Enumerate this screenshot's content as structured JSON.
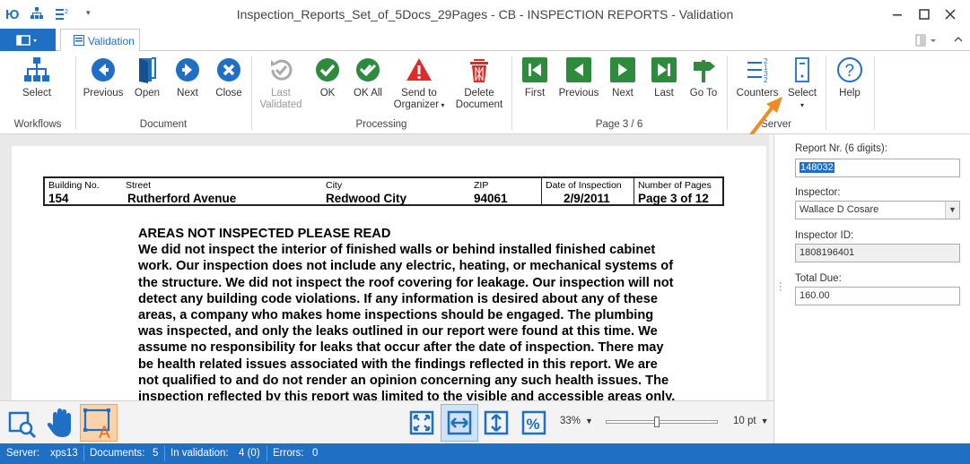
{
  "window": {
    "title": "Inspection_Reports_Set_of_5Docs_29Pages - CB - INSPECTION REPORTS - Validation"
  },
  "tabs": {
    "validation": "Validation"
  },
  "ribbon": {
    "workflows": {
      "group": "Workflows",
      "select": "Select"
    },
    "document": {
      "group": "Document",
      "previous": "Previous",
      "open": "Open",
      "next": "Next",
      "close": "Close"
    },
    "processing": {
      "group": "Processing",
      "last_validated_1": "Last",
      "last_validated_2": "Validated",
      "ok": "OK",
      "ok_all": "OK All",
      "send_1": "Send to",
      "send_2": "Organizer",
      "delete_1": "Delete",
      "delete_2": "Document"
    },
    "page": {
      "group": "Page 3 / 6",
      "first": "First",
      "previous": "Previous",
      "next": "Next",
      "last": "Last",
      "goto": "Go To"
    },
    "server": {
      "group": "Server",
      "counters": "Counters",
      "select": "Select"
    },
    "help": {
      "label": "Help"
    }
  },
  "document": {
    "header": {
      "building_label": "Building No.",
      "building_value": "154",
      "street_label": "Street",
      "street_value": "Rutherford Avenue",
      "city_label": "City",
      "city_value": "Redwood City",
      "zip_label": "ZIP",
      "zip_value": "94061",
      "date_label": "Date of Inspection",
      "date_value": "2/9/2011",
      "pages_label": "Number of Pages",
      "pages_value": "Page 3 of 12"
    },
    "heading": "AREAS NOT INSPECTED PLEASE READ",
    "lines": [
      "We did not inspect the interior of finished walls or behind installed finished cabinet",
      "work. Our inspection does not include any electric, heating, or mechanical systems of",
      "the structure. We did not inspect the roof covering for leakage. Our inspection will not",
      "detect any building code violations. If any information is desired about any of these",
      "areas, a company who makes home inspections should be engaged. The plumbing",
      "was inspected, and only the leaks outlined in our report were found at this time. We",
      "assume no responsibility for leaks that occur after the date of inspection. There may",
      "be health related issues associated with the findings reflected in this report. We are",
      "not qualified to and do not render an opinion concerning any such health issues. The",
      "inspection reflected by this report was limited to the visible and accessible areas only."
    ]
  },
  "fields": {
    "report_label": "Report Nr. (6 digits):",
    "report_value": "148032",
    "inspector_label": "Inspector:",
    "inspector_value": "Wallace D Cosare",
    "inspector_id_label": "Inspector ID:",
    "inspector_id_value": "1808196401",
    "total_label": "Total Due:",
    "total_value": "160.00"
  },
  "viewer": {
    "zoom": "33%",
    "font_size": "10 pt",
    "zoom_slider_fraction": 0.45
  },
  "status": {
    "server_label": "Server:",
    "server_value": "xps13",
    "documents_label": "Documents:",
    "documents_value": "5",
    "validation_label": "In validation:",
    "validation_value": "4 (0)",
    "errors_label": "Errors:",
    "errors_value": "0"
  },
  "colors": {
    "accent": "#1f6fc5",
    "blue_icon": "#1f6fc5",
    "green_icon": "#2e8b3d",
    "red_icon": "#e02a2a",
    "highlight": "#fbd2ab",
    "callout_arrow": "#f08a24"
  }
}
